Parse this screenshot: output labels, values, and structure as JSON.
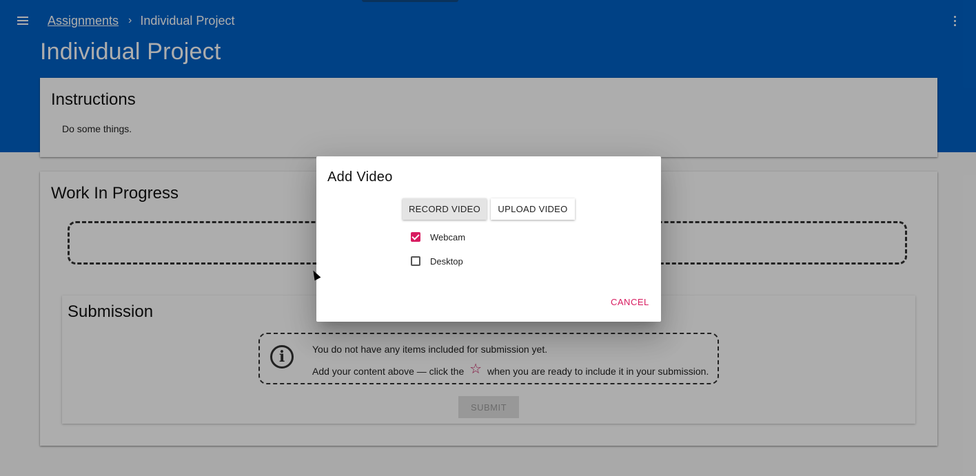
{
  "header": {
    "breadcrumb_link": "Assignments",
    "breadcrumb_current": "Individual Project",
    "page_title": "Individual Project",
    "chevron": "›",
    "menu_icon": "hamburger-icon",
    "more_icon": "more-vert-icon"
  },
  "instructions": {
    "title": "Instructions",
    "text": "Do some things."
  },
  "work_in_progress": {
    "title": "Work In Progress"
  },
  "submission": {
    "title": "Submission",
    "info_line1": "You do not have any items included for submission yet.",
    "info_line2_before": "Add your content above — click the",
    "info_line2_after": "when you are ready to include it in your submission.",
    "star_glyph": "☆",
    "info_glyph": "i",
    "submit_label": "SUBMIT"
  },
  "dialog": {
    "title": "Add Video",
    "record_label": "RECORD VIDEO",
    "upload_label": "UPLOAD VIDEO",
    "options": [
      {
        "label": "Webcam",
        "checked": true
      },
      {
        "label": "Desktop",
        "checked": false
      }
    ],
    "cancel_label": "CANCEL"
  },
  "colors": {
    "header_bg": "#0061c5",
    "accent": "#d81b60"
  }
}
